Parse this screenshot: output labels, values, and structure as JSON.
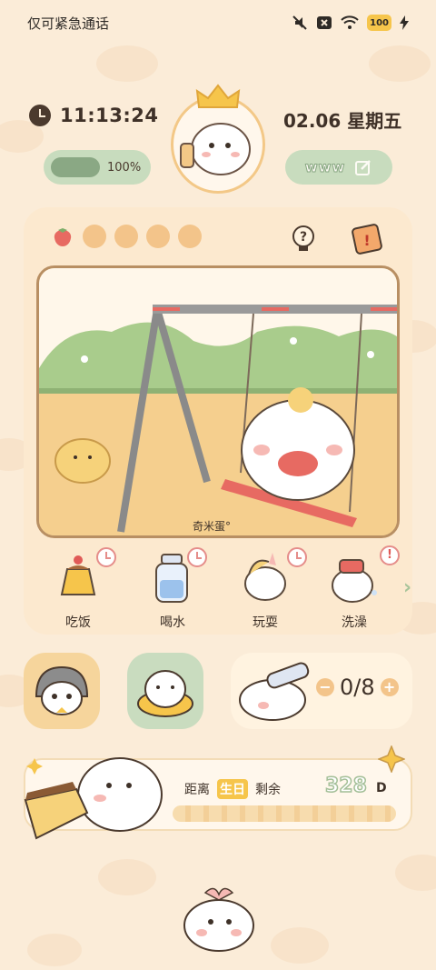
{
  "statusbar": {
    "carrier": "仅可紧急通话",
    "battery": "100"
  },
  "header": {
    "time": "11:13:24",
    "date": "02.06 星期五",
    "progress_percent": 100,
    "progress_label": "100%",
    "link_label": "www"
  },
  "stats": {
    "hearts_total": 5,
    "hearts_filled": 0
  },
  "scene": {
    "caption": "奇米蛋°"
  },
  "actions": [
    {
      "label": "吃饭",
      "badge": "clock"
    },
    {
      "label": "喝水",
      "badge": "clock"
    },
    {
      "label": "玩耍",
      "badge": "clock"
    },
    {
      "label": "洗澡",
      "badge": "alert"
    }
  ],
  "water": {
    "count": "0/8",
    "minus": "−",
    "plus": "+"
  },
  "birthday": {
    "prefix": "距离",
    "highlight": "生日",
    "suffix": "剩余",
    "days": "328",
    "unit": "D"
  },
  "colors": {
    "background": "#fbecd8",
    "accent_green": "#c8dcbe",
    "accent_orange": "#f3c48a"
  }
}
